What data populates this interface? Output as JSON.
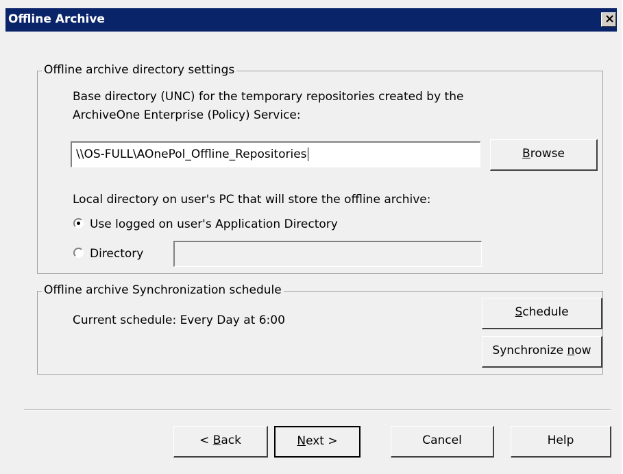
{
  "window": {
    "title": "Offline Archive",
    "close_glyph": "×"
  },
  "directory_group": {
    "legend": "Offline archive directory settings",
    "base_label_line1": "Base directory (UNC) for the temporary repositories created by the",
    "base_label_line2": "ArchiveOne Enterprise (Policy) Service:",
    "base_value": "\\\\OS-FULL\\AOnePol_Offline_Repositories",
    "browse_pre": "",
    "browse_mnemonic": "B",
    "browse_post": "rowse",
    "local_label": "Local directory on user's PC that will store the offline archive:",
    "radio_app_dir_label": "Use logged on user's Application Directory",
    "radio_app_dir_selected": true,
    "radio_directory_label": "Directory",
    "directory_value": ""
  },
  "schedule_group": {
    "legend": "Offline archive Synchronization schedule",
    "current_schedule": "Current schedule: Every Day at 6:00",
    "schedule_pre": "",
    "schedule_mnemonic": "S",
    "schedule_post": "chedule",
    "sync_pre": "Synchronize ",
    "sync_mnemonic": "n",
    "sync_post": "ow"
  },
  "footer": {
    "back_pre": "< ",
    "back_mnemonic": "B",
    "back_post": "ack",
    "next_pre": "",
    "next_mnemonic": "N",
    "next_post": "ext >",
    "cancel_label": "Cancel",
    "help_label": "Help"
  }
}
